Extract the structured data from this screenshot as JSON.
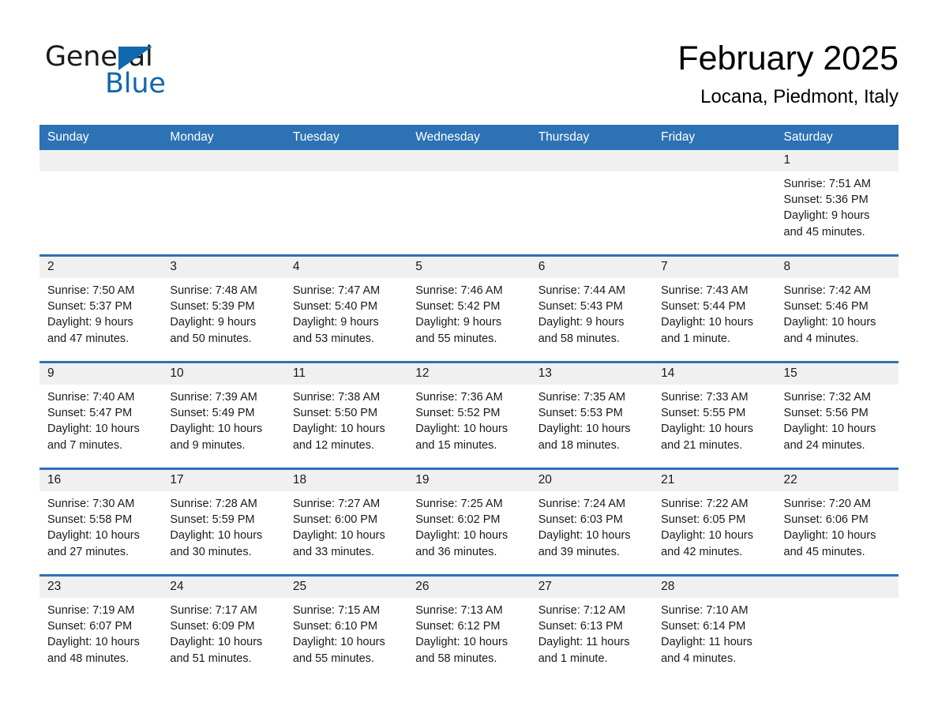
{
  "brand": {
    "word1": "General",
    "word2": "Blue",
    "triangle_color": "#1068ad",
    "blue_color": "#1068ad"
  },
  "header": {
    "month_title": "February 2025",
    "location": "Locana, Piedmont, Italy"
  },
  "theme": {
    "header_blue": "#2d72b5",
    "row_divider_blue": "#2d72b5",
    "daynum_bg": "#f0f0f0"
  },
  "weekday_headers": [
    "Sunday",
    "Monday",
    "Tuesday",
    "Wednesday",
    "Thursday",
    "Friday",
    "Saturday"
  ],
  "weeks": [
    [
      {
        "day": "",
        "sunrise": "",
        "sunset": "",
        "daylight1": "",
        "daylight2": ""
      },
      {
        "day": "",
        "sunrise": "",
        "sunset": "",
        "daylight1": "",
        "daylight2": ""
      },
      {
        "day": "",
        "sunrise": "",
        "sunset": "",
        "daylight1": "",
        "daylight2": ""
      },
      {
        "day": "",
        "sunrise": "",
        "sunset": "",
        "daylight1": "",
        "daylight2": ""
      },
      {
        "day": "",
        "sunrise": "",
        "sunset": "",
        "daylight1": "",
        "daylight2": ""
      },
      {
        "day": "",
        "sunrise": "",
        "sunset": "",
        "daylight1": "",
        "daylight2": ""
      },
      {
        "day": "1",
        "sunrise": "Sunrise: 7:51 AM",
        "sunset": "Sunset: 5:36 PM",
        "daylight1": "Daylight: 9 hours",
        "daylight2": "and 45 minutes."
      }
    ],
    [
      {
        "day": "2",
        "sunrise": "Sunrise: 7:50 AM",
        "sunset": "Sunset: 5:37 PM",
        "daylight1": "Daylight: 9 hours",
        "daylight2": "and 47 minutes."
      },
      {
        "day": "3",
        "sunrise": "Sunrise: 7:48 AM",
        "sunset": "Sunset: 5:39 PM",
        "daylight1": "Daylight: 9 hours",
        "daylight2": "and 50 minutes."
      },
      {
        "day": "4",
        "sunrise": "Sunrise: 7:47 AM",
        "sunset": "Sunset: 5:40 PM",
        "daylight1": "Daylight: 9 hours",
        "daylight2": "and 53 minutes."
      },
      {
        "day": "5",
        "sunrise": "Sunrise: 7:46 AM",
        "sunset": "Sunset: 5:42 PM",
        "daylight1": "Daylight: 9 hours",
        "daylight2": "and 55 minutes."
      },
      {
        "day": "6",
        "sunrise": "Sunrise: 7:44 AM",
        "sunset": "Sunset: 5:43 PM",
        "daylight1": "Daylight: 9 hours",
        "daylight2": "and 58 minutes."
      },
      {
        "day": "7",
        "sunrise": "Sunrise: 7:43 AM",
        "sunset": "Sunset: 5:44 PM",
        "daylight1": "Daylight: 10 hours",
        "daylight2": "and 1 minute."
      },
      {
        "day": "8",
        "sunrise": "Sunrise: 7:42 AM",
        "sunset": "Sunset: 5:46 PM",
        "daylight1": "Daylight: 10 hours",
        "daylight2": "and 4 minutes."
      }
    ],
    [
      {
        "day": "9",
        "sunrise": "Sunrise: 7:40 AM",
        "sunset": "Sunset: 5:47 PM",
        "daylight1": "Daylight: 10 hours",
        "daylight2": "and 7 minutes."
      },
      {
        "day": "10",
        "sunrise": "Sunrise: 7:39 AM",
        "sunset": "Sunset: 5:49 PM",
        "daylight1": "Daylight: 10 hours",
        "daylight2": "and 9 minutes."
      },
      {
        "day": "11",
        "sunrise": "Sunrise: 7:38 AM",
        "sunset": "Sunset: 5:50 PM",
        "daylight1": "Daylight: 10 hours",
        "daylight2": "and 12 minutes."
      },
      {
        "day": "12",
        "sunrise": "Sunrise: 7:36 AM",
        "sunset": "Sunset: 5:52 PM",
        "daylight1": "Daylight: 10 hours",
        "daylight2": "and 15 minutes."
      },
      {
        "day": "13",
        "sunrise": "Sunrise: 7:35 AM",
        "sunset": "Sunset: 5:53 PM",
        "daylight1": "Daylight: 10 hours",
        "daylight2": "and 18 minutes."
      },
      {
        "day": "14",
        "sunrise": "Sunrise: 7:33 AM",
        "sunset": "Sunset: 5:55 PM",
        "daylight1": "Daylight: 10 hours",
        "daylight2": "and 21 minutes."
      },
      {
        "day": "15",
        "sunrise": "Sunrise: 7:32 AM",
        "sunset": "Sunset: 5:56 PM",
        "daylight1": "Daylight: 10 hours",
        "daylight2": "and 24 minutes."
      }
    ],
    [
      {
        "day": "16",
        "sunrise": "Sunrise: 7:30 AM",
        "sunset": "Sunset: 5:58 PM",
        "daylight1": "Daylight: 10 hours",
        "daylight2": "and 27 minutes."
      },
      {
        "day": "17",
        "sunrise": "Sunrise: 7:28 AM",
        "sunset": "Sunset: 5:59 PM",
        "daylight1": "Daylight: 10 hours",
        "daylight2": "and 30 minutes."
      },
      {
        "day": "18",
        "sunrise": "Sunrise: 7:27 AM",
        "sunset": "Sunset: 6:00 PM",
        "daylight1": "Daylight: 10 hours",
        "daylight2": "and 33 minutes."
      },
      {
        "day": "19",
        "sunrise": "Sunrise: 7:25 AM",
        "sunset": "Sunset: 6:02 PM",
        "daylight1": "Daylight: 10 hours",
        "daylight2": "and 36 minutes."
      },
      {
        "day": "20",
        "sunrise": "Sunrise: 7:24 AM",
        "sunset": "Sunset: 6:03 PM",
        "daylight1": "Daylight: 10 hours",
        "daylight2": "and 39 minutes."
      },
      {
        "day": "21",
        "sunrise": "Sunrise: 7:22 AM",
        "sunset": "Sunset: 6:05 PM",
        "daylight1": "Daylight: 10 hours",
        "daylight2": "and 42 minutes."
      },
      {
        "day": "22",
        "sunrise": "Sunrise: 7:20 AM",
        "sunset": "Sunset: 6:06 PM",
        "daylight1": "Daylight: 10 hours",
        "daylight2": "and 45 minutes."
      }
    ],
    [
      {
        "day": "23",
        "sunrise": "Sunrise: 7:19 AM",
        "sunset": "Sunset: 6:07 PM",
        "daylight1": "Daylight: 10 hours",
        "daylight2": "and 48 minutes."
      },
      {
        "day": "24",
        "sunrise": "Sunrise: 7:17 AM",
        "sunset": "Sunset: 6:09 PM",
        "daylight1": "Daylight: 10 hours",
        "daylight2": "and 51 minutes."
      },
      {
        "day": "25",
        "sunrise": "Sunrise: 7:15 AM",
        "sunset": "Sunset: 6:10 PM",
        "daylight1": "Daylight: 10 hours",
        "daylight2": "and 55 minutes."
      },
      {
        "day": "26",
        "sunrise": "Sunrise: 7:13 AM",
        "sunset": "Sunset: 6:12 PM",
        "daylight1": "Daylight: 10 hours",
        "daylight2": "and 58 minutes."
      },
      {
        "day": "27",
        "sunrise": "Sunrise: 7:12 AM",
        "sunset": "Sunset: 6:13 PM",
        "daylight1": "Daylight: 11 hours",
        "daylight2": "and 1 minute."
      },
      {
        "day": "28",
        "sunrise": "Sunrise: 7:10 AM",
        "sunset": "Sunset: 6:14 PM",
        "daylight1": "Daylight: 11 hours",
        "daylight2": "and 4 minutes."
      },
      {
        "day": "",
        "sunrise": "",
        "sunset": "",
        "daylight1": "",
        "daylight2": ""
      }
    ]
  ]
}
